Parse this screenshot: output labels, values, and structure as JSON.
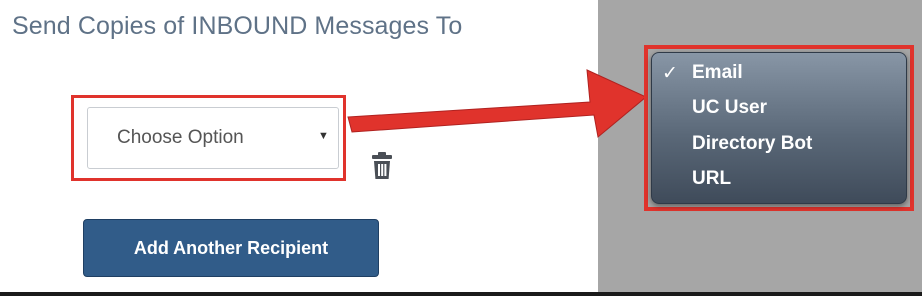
{
  "section_title": "Send Copies of INBOUND Messages To",
  "select": {
    "value": "Choose Option",
    "arrow_glyph": "▼"
  },
  "trash_icon": "trash-icon",
  "add_button_label": "Add Another Recipient",
  "dropdown_menu": {
    "check_glyph": "✓",
    "selected": "Email",
    "items": [
      "Email",
      "UC User",
      "Directory Bot",
      "URL"
    ]
  },
  "colors": {
    "title": "#5f7287",
    "highlight": "#e0332c",
    "button": "#315c89",
    "menu_dark": "#3f4b5a"
  }
}
